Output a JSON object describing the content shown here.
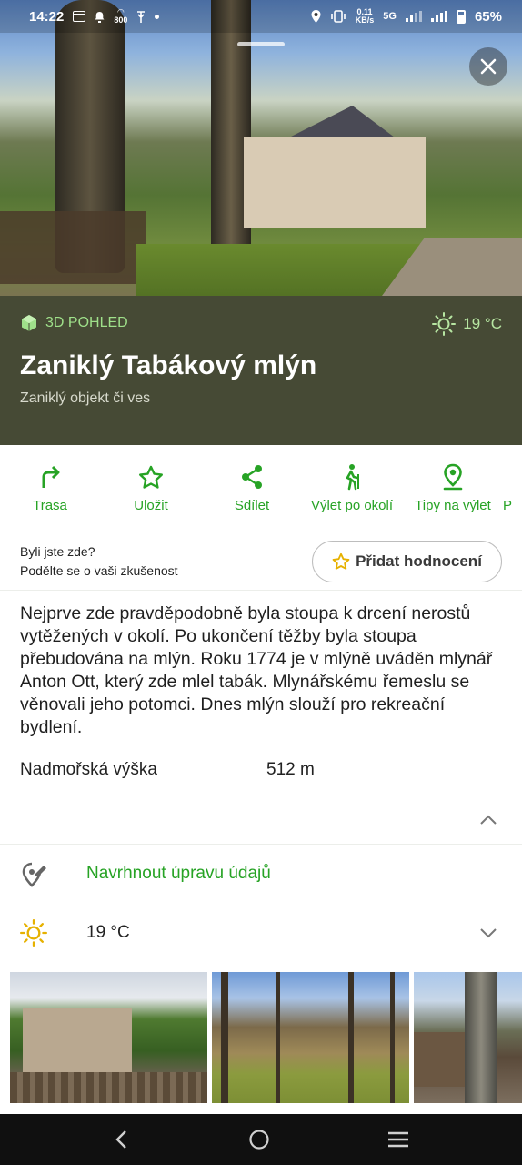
{
  "status_bar": {
    "time": "14:22",
    "network_speed_top": "0.11",
    "network_speed_unit": "KB/s",
    "network_type": "5G",
    "battery": "65%",
    "notif_badge": "800"
  },
  "hero": {
    "close_icon": "close-icon"
  },
  "header": {
    "view3d_label": "3D POHLED",
    "temperature": "19 °C",
    "title": "Zaniklý Tabákový mlýn",
    "subtitle": "Zaniklý objekt či ves"
  },
  "actions": [
    {
      "label": "Trasa",
      "icon": "route-arrow-icon"
    },
    {
      "label": "Uložit",
      "icon": "star-outline-icon"
    },
    {
      "label": "Sdílet",
      "icon": "share-icon"
    },
    {
      "label": "Výlet po okolí",
      "icon": "hiker-icon"
    },
    {
      "label": "Tipy na výlet",
      "icon": "map-pin-icon"
    }
  ],
  "rating": {
    "question": "Byli jste zde?",
    "prompt": "Podělte se o vaši zkušenost",
    "button_label": "Přidat hodnocení"
  },
  "description": "Nejprve zde pravděpodobně byla stoupa k drcení nerostů vytěžených v okolí. Po ukončení těžby byla stoupa přebudována na mlýn. Roku 1774 je v mlýně uváděn mlynář Anton Ott, který zde mlel tabák. Mlynářskému řemeslu se věnovali jeho potomci. Dnes mlýn slouží pro rekreační bydlení.",
  "elevation": {
    "label": "Nadmořská výška",
    "value": "512 m"
  },
  "suggest_edit": {
    "label": "Navrhnout úpravu údajů"
  },
  "weather": {
    "label": "19 °C"
  },
  "colors": {
    "accent_green": "#27a325",
    "header_bg": "#464a35",
    "header_green": "#9fe08a"
  }
}
